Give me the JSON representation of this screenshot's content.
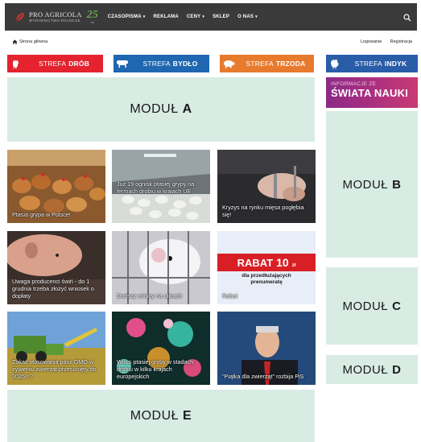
{
  "header": {
    "logo_title": "PRO AGRICOLA",
    "logo_subtitle": "WYDAWNICTWO ROLNICZE",
    "anniversary_number": "25",
    "anniversary_text": "lat",
    "menu": [
      {
        "label": "CZASOPISMA",
        "dropdown": true
      },
      {
        "label": "REKLAMA",
        "dropdown": false
      },
      {
        "label": "CENY",
        "dropdown": true
      },
      {
        "label": "SKLEP",
        "dropdown": false
      },
      {
        "label": "O NAS",
        "dropdown": true
      }
    ],
    "search_icon": "search-icon"
  },
  "subbar": {
    "home_label": "Strona główna",
    "login_label": "Logowanie",
    "register_label": "Registracja"
  },
  "zones": [
    {
      "prefix": "STREFA",
      "name": "DRÓB",
      "color": "#e4232e",
      "icon": "chicken-icon"
    },
    {
      "prefix": "STREFA",
      "name": "BYDŁO",
      "color": "#1f67b1",
      "icon": "cow-icon"
    },
    {
      "prefix": "STREFA",
      "name": "TRZODA",
      "color": "#e87a2e",
      "icon": "pig-icon"
    },
    {
      "prefix": "STREFA",
      "name": "INDYK",
      "color": "#2a5da8",
      "icon": "turkey-icon"
    }
  ],
  "banner_nauki": {
    "line1": "INFORMACJE ZE",
    "line2": "ŚWIATA NAUKI"
  },
  "modules": {
    "a": {
      "word": "MODUŁ",
      "letter": "A"
    },
    "b": {
      "word": "MODUŁ",
      "letter": "B"
    },
    "c": {
      "word": "MODUŁ",
      "letter": "C"
    },
    "d": {
      "word": "MODUŁ",
      "letter": "D"
    },
    "e": {
      "word": "MODUŁ",
      "letter": "E"
    }
  },
  "articles": [
    {
      "title": "Ptasia grypa w Polsce!"
    },
    {
      "title": "Już 19 ognisk ptasiej grypy na fermach drobiu w krajach UE"
    },
    {
      "title": "Kryzys na rynku mięsa pogłębia się!"
    },
    {
      "title": "Uwaga producenci świń - do 1 grudnia trzeba złożyć wniosek o dopłaty"
    },
    {
      "title": "Duńscy rolnicy na ulicach"
    },
    {
      "title": "Rabat"
    },
    {
      "title": "Zakaz stosowania pasz GMO w żywieniu zwierząt przesunięty do 2025 r.?"
    },
    {
      "title": "Wirus ptasiej grypy w stadach drobiu w kilku krajach europejskich"
    },
    {
      "title": "\"Piątka dla zwierząt\" rozbija PiS"
    }
  ],
  "rabat_ad": {
    "word": "RABAT",
    "number": "10",
    "unit": "zł",
    "line1": "dla przedłużających",
    "line2": "prenumeratę"
  }
}
